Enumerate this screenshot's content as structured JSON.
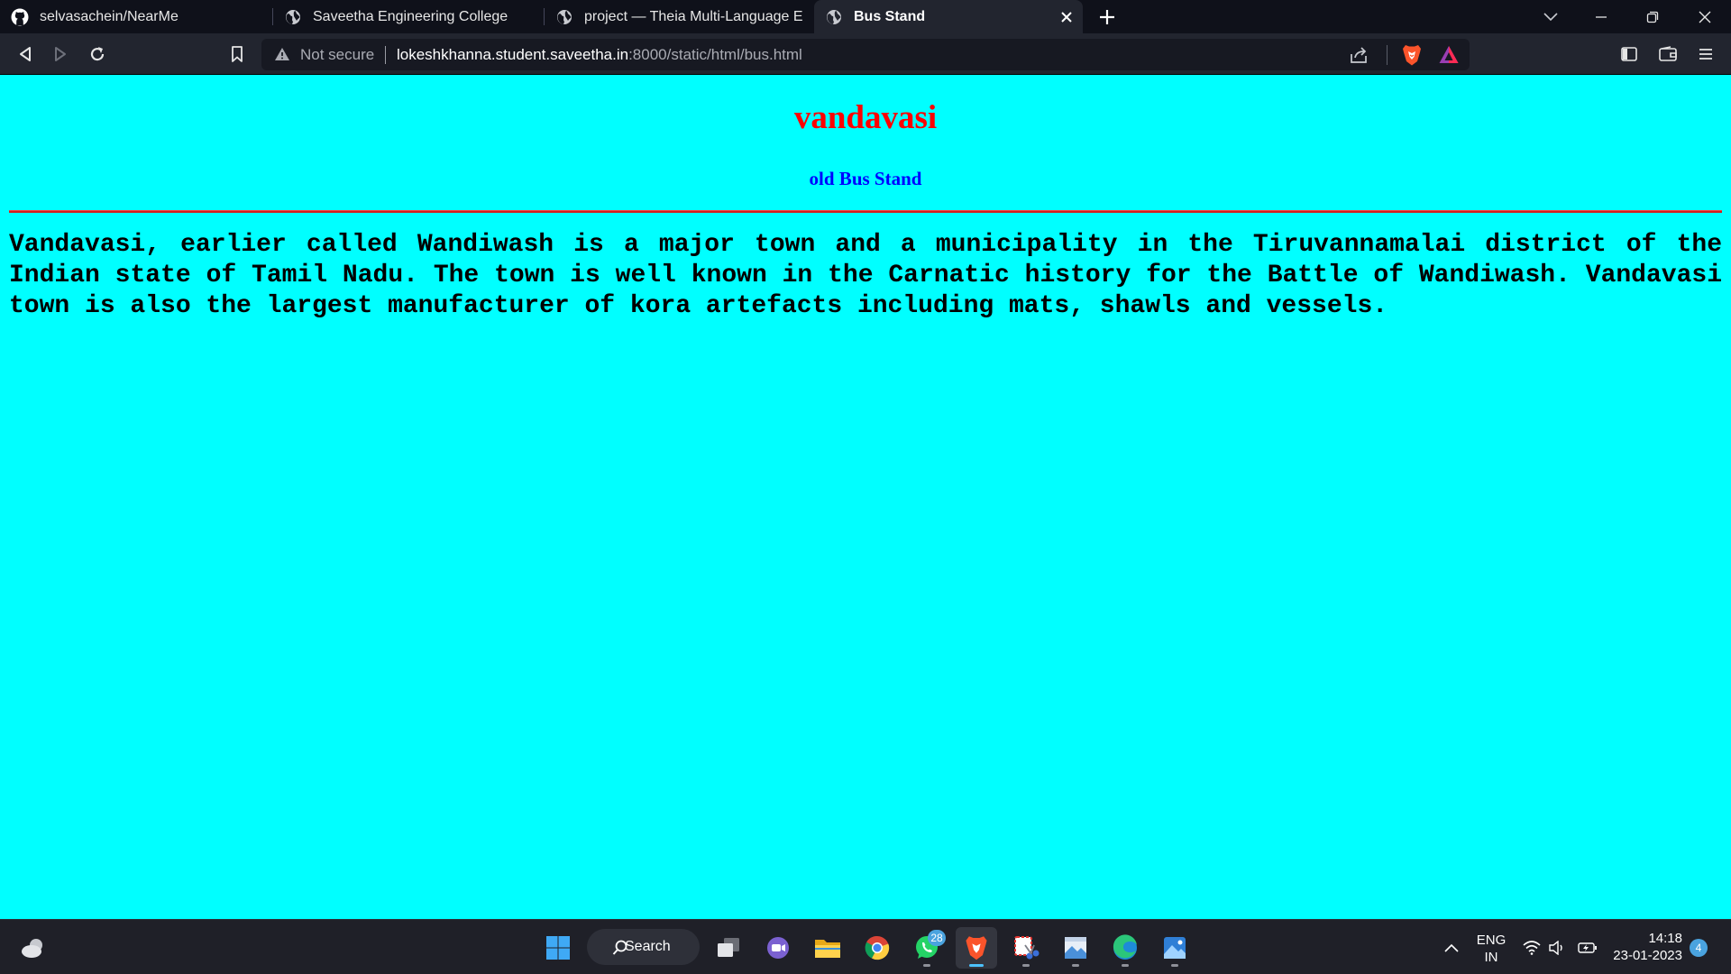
{
  "browser": {
    "tabs": [
      {
        "title": "selvasachein/NearMe",
        "icon": "github-icon"
      },
      {
        "title": "Saveetha Engineering College",
        "icon": "globe-icon"
      },
      {
        "title": "project — Theia Multi-Language Exam",
        "icon": "globe-icon"
      },
      {
        "title": "Bus Stand",
        "icon": "globe-icon",
        "active": true
      }
    ],
    "omnibox": {
      "security_label": "Not secure",
      "url_host": "lokeshkhanna.student.saveetha.in",
      "url_rest": ":8000/static/html/bus.html"
    }
  },
  "page": {
    "heading": "vandavasi",
    "subheading": "old Bus Stand",
    "paragraph": "Vandavasi, earlier called Wandiwash is a major town and a municipality in the Tiruvannamalai district of the Indian state of Tamil Nadu. The town is well known in the Carnatic history for the Battle of Wandiwash. Vandavasi town is also the largest manufacturer of kora artefacts including mats, shawls and vessels.",
    "colors": {
      "background": "#00ffff",
      "heading": "#ff0000",
      "subheading": "#0000ff",
      "rule": "#d11f1f"
    }
  },
  "taskbar": {
    "search_label": "Search",
    "whatsapp_badge": "28",
    "language_line1": "ENG",
    "language_line2": "IN",
    "time": "14:18",
    "date": "23-01-2023",
    "notification_count": "4"
  }
}
